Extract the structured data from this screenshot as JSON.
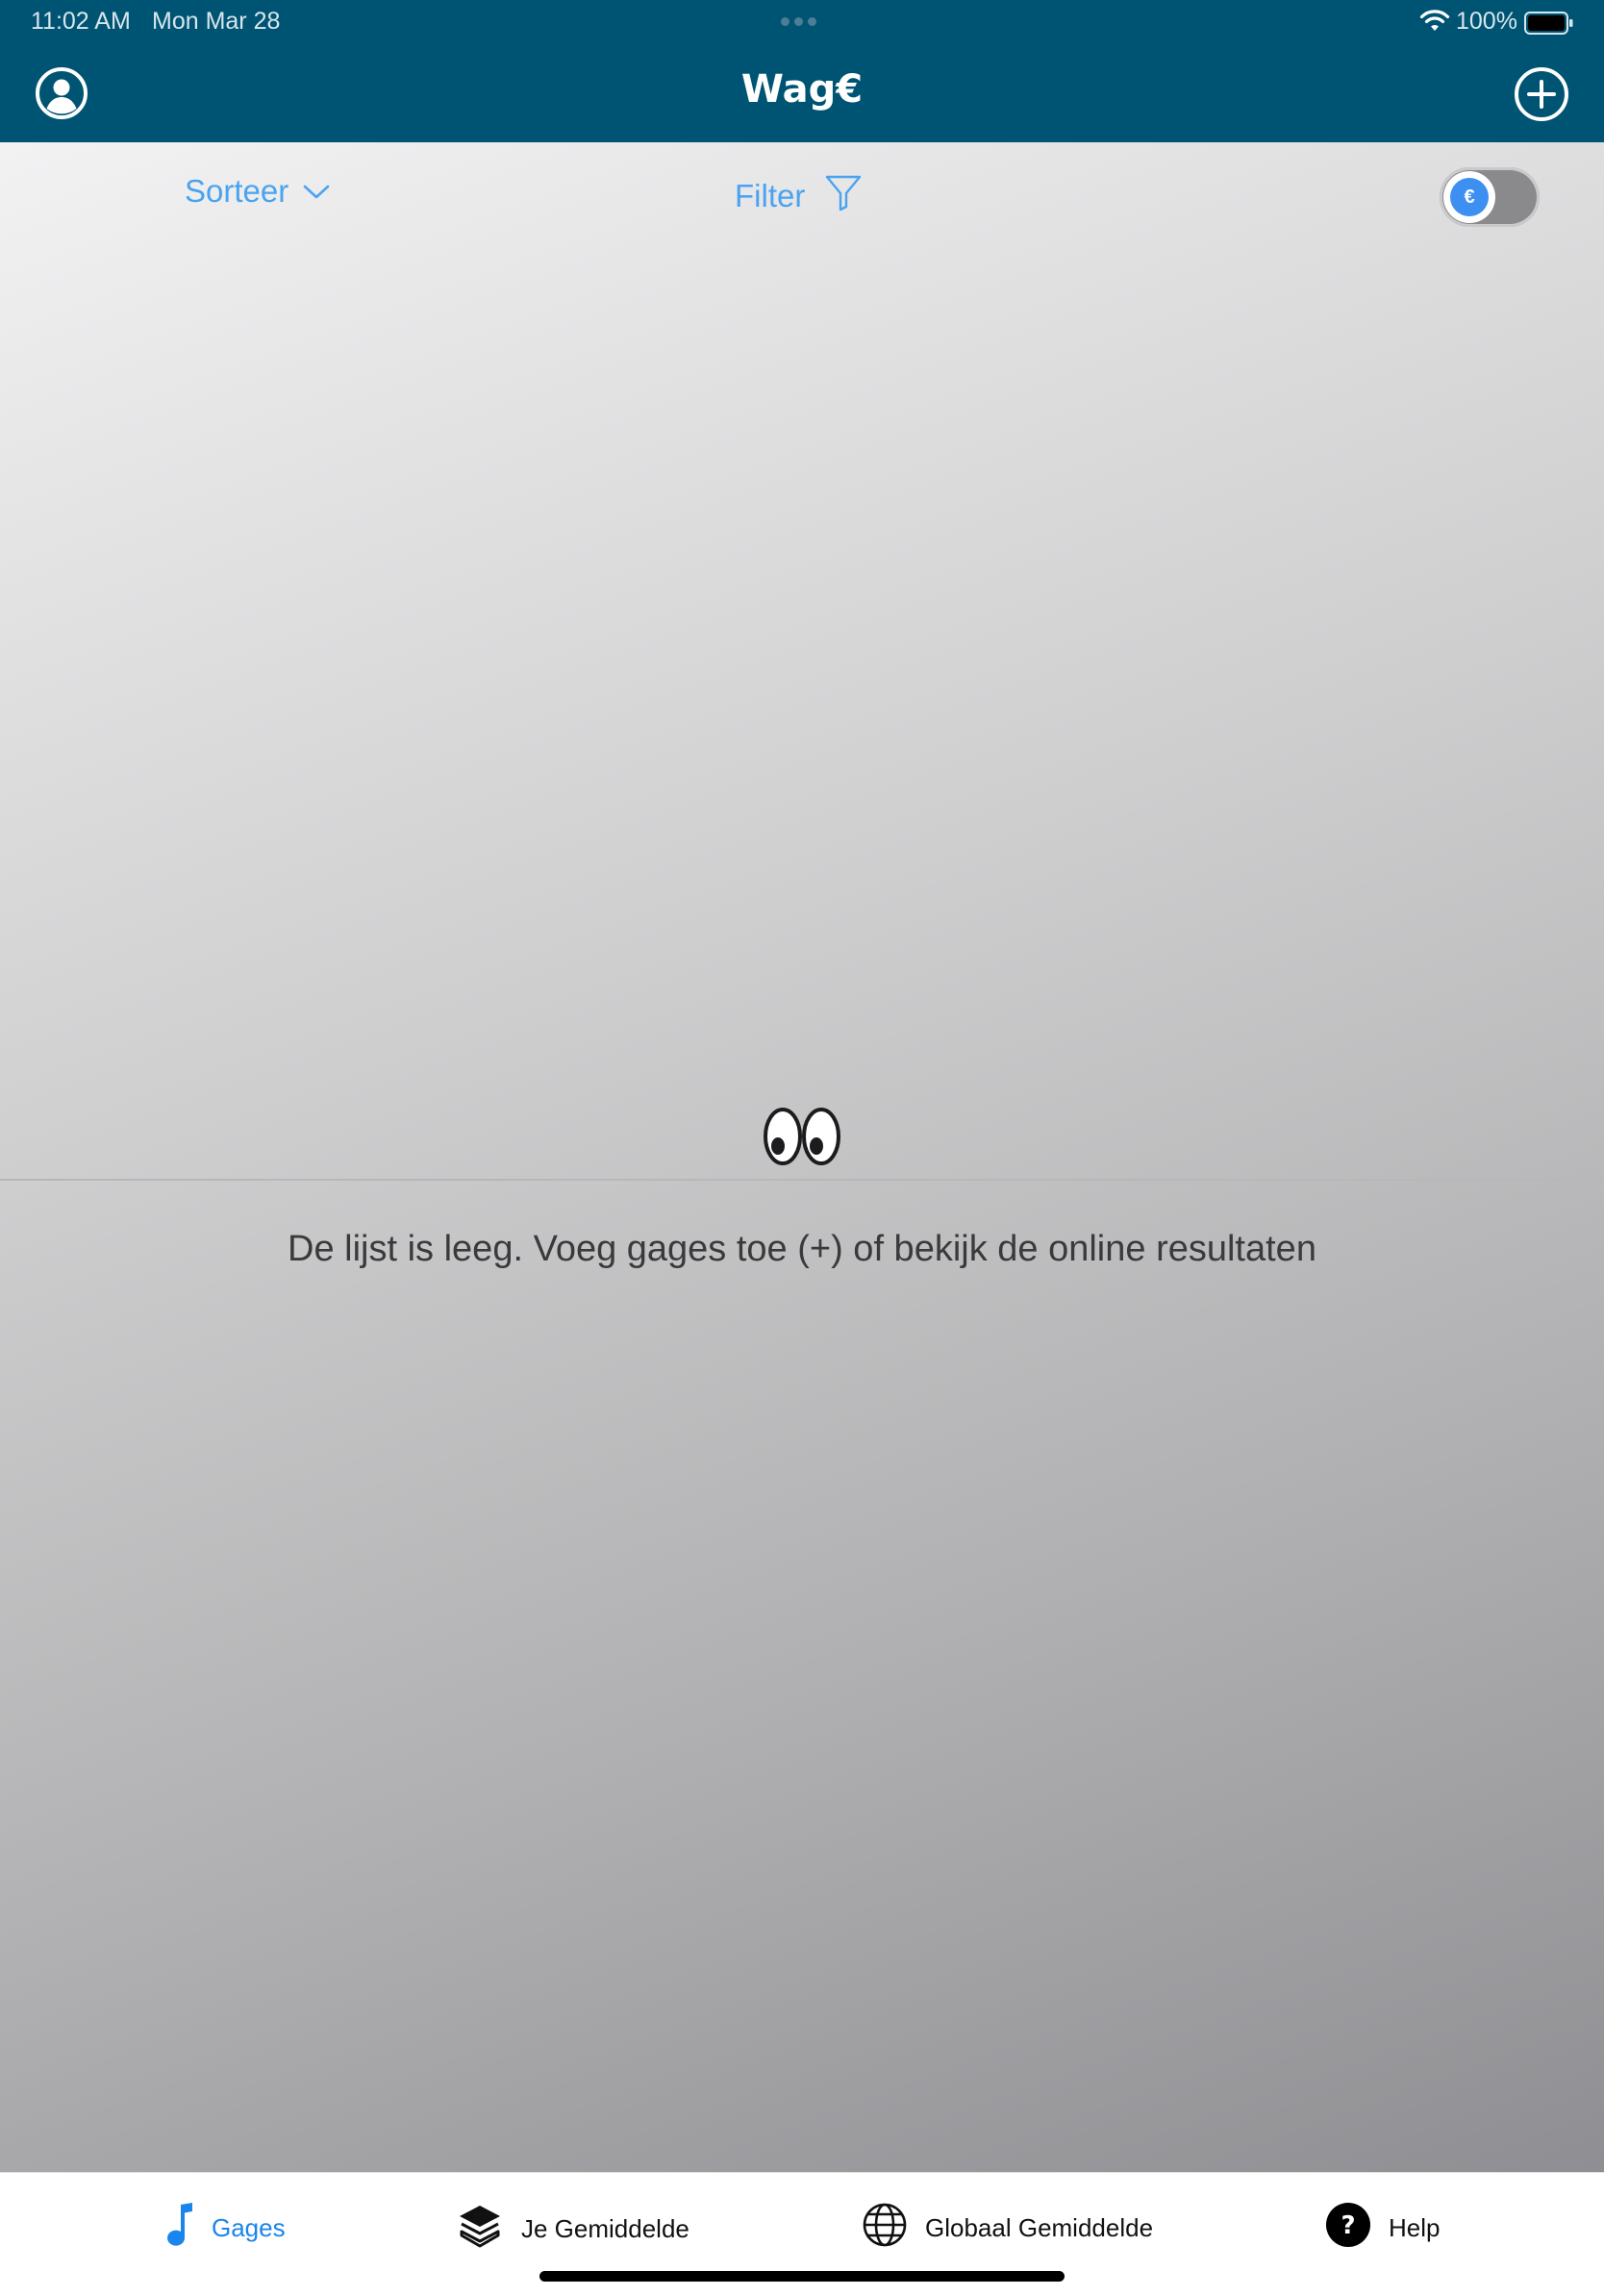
{
  "status_bar": {
    "time": "11:02 AM",
    "date": "Mon Mar 28",
    "battery": "100%"
  },
  "header": {
    "logo_text": "Wag€",
    "profile_icon": "person-circle-icon",
    "add_icon": "plus-circle-icon",
    "background_color": "#005473"
  },
  "toolbar": {
    "sort_label": "Sorteer",
    "filter_label": "Filter",
    "currency_toggle_symbol": "€",
    "currency_toggle_on": false
  },
  "empty_state": {
    "icon": "eyes-icon",
    "message": "De lijst is leeg. Voeg gages toe (+) of bekijk de online resultaten"
  },
  "tabbar": {
    "tabs": [
      {
        "label": "Gages",
        "icon": "music-note-icon",
        "active": true
      },
      {
        "label": "Je Gemiddelde",
        "icon": "layers-icon",
        "active": false
      },
      {
        "label": "Globaal Gemiddelde",
        "icon": "globe-icon",
        "active": false
      },
      {
        "label": "Help",
        "icon": "question-circle-icon",
        "active": false
      }
    ],
    "active_color": "#1a85ec"
  }
}
